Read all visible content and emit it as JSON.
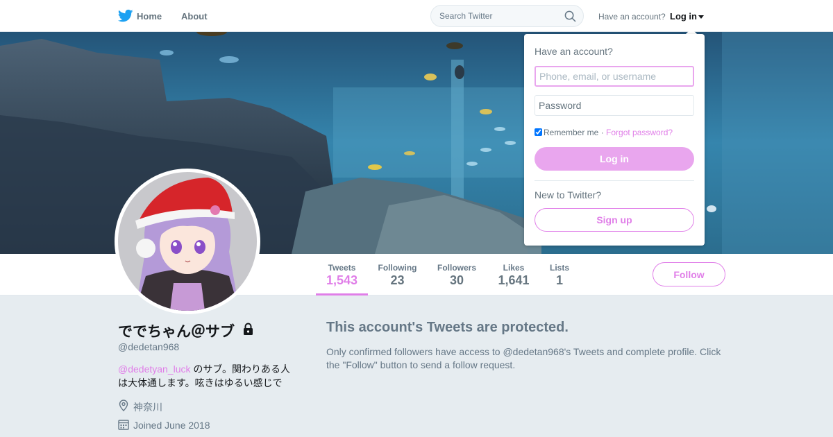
{
  "nav": {
    "home_label": "Home",
    "about_label": "About",
    "search_placeholder": "Search Twitter",
    "have_account": "Have an account?",
    "login_label": "Log in"
  },
  "profile": {
    "display_name": "ででちゃん＠サブ",
    "screen_name": "@dedetan968",
    "bio_mention": "@dedetyan_luck",
    "bio_text": " のサブ。関わりある人は大体通します。呟きはゆるい感じで",
    "location": "神奈川",
    "joined": "Joined June 2018"
  },
  "stats": [
    {
      "label": "Tweets",
      "value": "1,543",
      "active": true
    },
    {
      "label": "Following",
      "value": "23"
    },
    {
      "label": "Followers",
      "value": "30"
    },
    {
      "label": "Likes",
      "value": "1,641"
    },
    {
      "label": "Lists",
      "value": "1"
    }
  ],
  "follow_label": "Follow",
  "protected": {
    "title": "This account's Tweets are protected.",
    "text": "Only confirmed followers have access to @dedetan968's Tweets and complete profile. Click the \"Follow\" button to send a follow request."
  },
  "login_dropdown": {
    "title": "Have an account?",
    "username_placeholder": "Phone, email, or username",
    "password_placeholder": "Password",
    "remember_label": "Remember me",
    "separator": " · ",
    "forgot_label": "Forgot password?",
    "login_button": "Log in",
    "new_label": "New to Twitter?",
    "signup_button": "Sign up"
  },
  "colors": {
    "accent": "#e07ee8",
    "accent_light": "#e9a6ee",
    "twitter_blue": "#1da1f2",
    "text_muted": "#657786",
    "page_bg": "#e6ecf0"
  },
  "icons": {
    "logo": "twitter-bird-icon",
    "search": "search-icon",
    "lock": "lock-icon",
    "location": "location-icon",
    "calendar": "calendar-icon"
  }
}
